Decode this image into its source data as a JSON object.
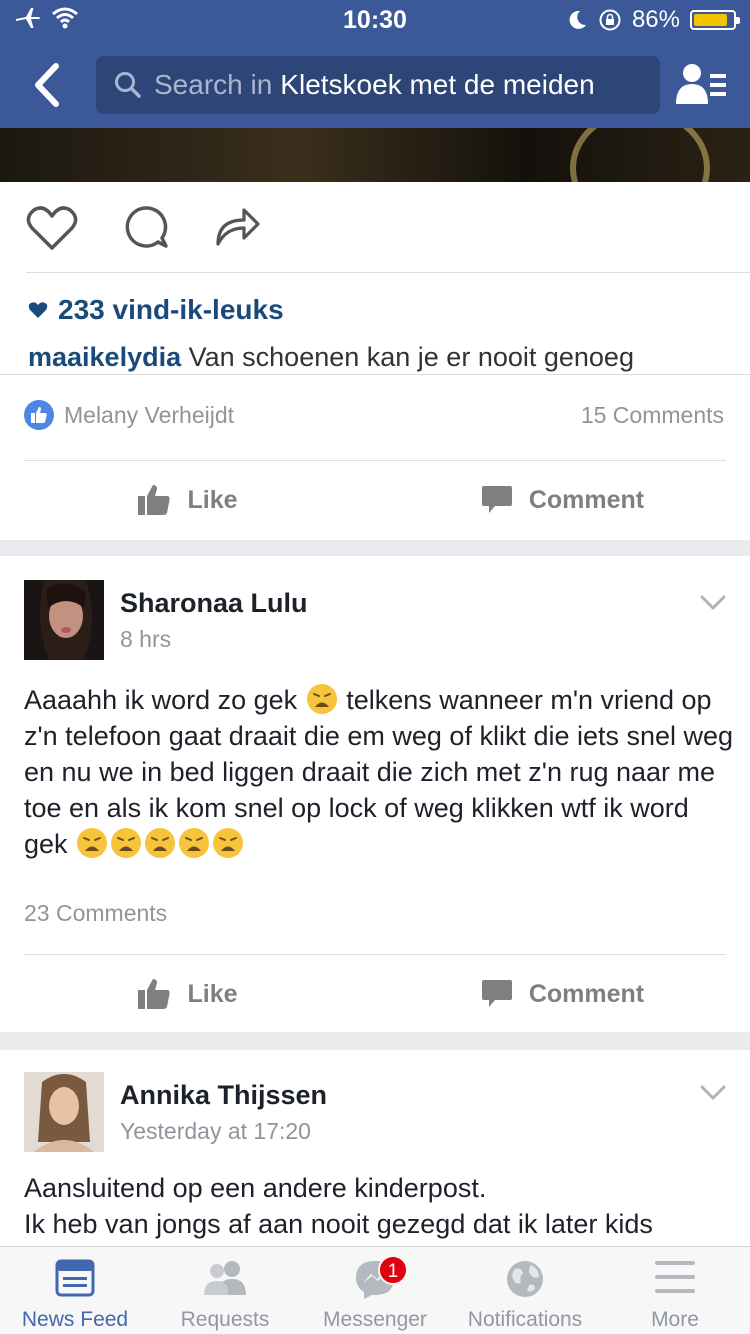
{
  "status": {
    "time": "10:30",
    "battery": "86%",
    "battery_level": 0.86
  },
  "nav": {
    "search_prefix": "Search in",
    "group_name": "Kletskoek met de meiden"
  },
  "post1": {
    "ig_likes": "233 vind-ik-leuks",
    "ig_user": "maaikelydia",
    "ig_caption": "Van schoenen kan je er nooit genoeg",
    "liked_by": "Melany Verheijdt",
    "comments": "15 Comments",
    "like_label": "Like",
    "comment_label": "Comment"
  },
  "post2": {
    "author": "Sharonaa Lulu",
    "time": "8 hrs",
    "text_a": "Aaaahh ik word zo gek",
    "text_b": "telkens wanneer m'n vriend op z'n telefoon gaat draait die em weg of klikt die iets snel weg en nu we in bed liggen draait die zich met z'n rug naar me toe en als ik kom snel op lock of weg klikken wtf ik word gek",
    "comments": "23 Comments",
    "like_label": "Like",
    "comment_label": "Comment"
  },
  "post3": {
    "author": "Annika Thijssen",
    "time": "Yesterday at 17:20",
    "text_line1": "Aansluitend op een andere kinderpost.",
    "text_line2": "Ik heb van jongs af aan nooit gezegd dat ik later kids"
  },
  "tabs": {
    "news_feed": "News Feed",
    "requests": "Requests",
    "messenger": "Messenger",
    "messenger_badge": "1",
    "notifications": "Notifications",
    "more": "More"
  },
  "colors": {
    "brand": "#3b5998",
    "active_tab": "#4267b2",
    "badge": "#e0000f"
  }
}
